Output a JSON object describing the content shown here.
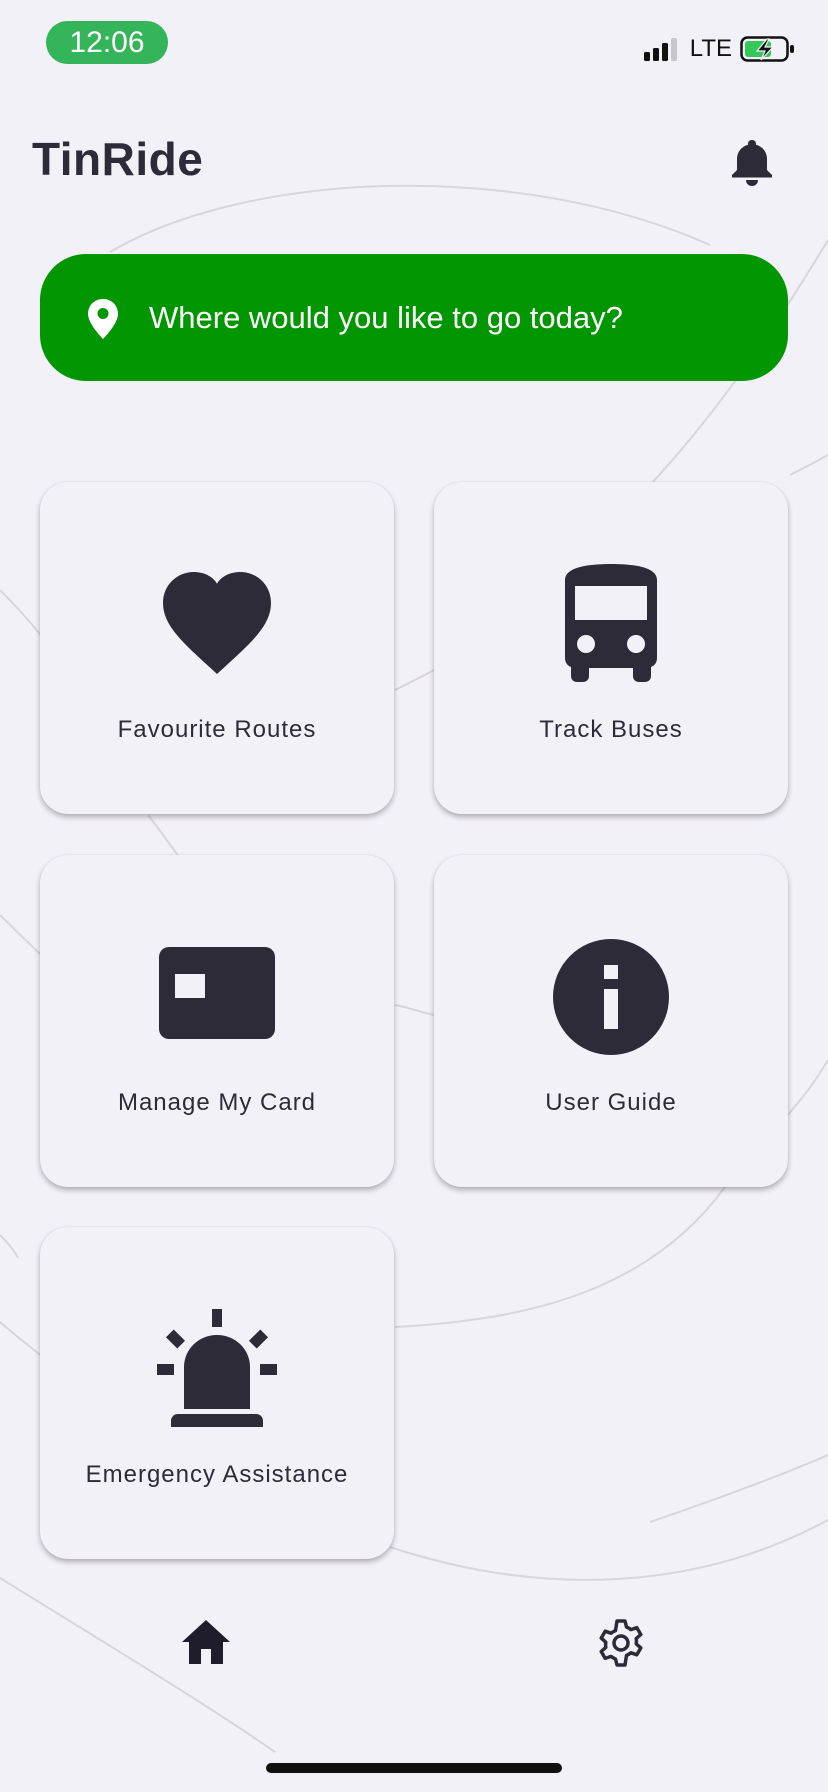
{
  "status_bar": {
    "time": "12:06",
    "network": "LTE",
    "time_pill_color": "#34b55a"
  },
  "header": {
    "title": "TinRide",
    "bell_icon": "bell-icon"
  },
  "search": {
    "placeholder": "Where would you like to go today?",
    "icon": "location-pin-icon",
    "background_color": "#029602"
  },
  "tiles": [
    {
      "label": "Favourite Routes",
      "icon": "heart-icon"
    },
    {
      "label": "Track Buses",
      "icon": "bus-icon"
    },
    {
      "label": "Manage My Card",
      "icon": "card-icon"
    },
    {
      "label": "User Guide",
      "icon": "info-icon"
    },
    {
      "label": "Emergency Assistance",
      "icon": "siren-icon"
    }
  ],
  "bottom_nav": {
    "items": [
      {
        "icon": "home-icon",
        "selected": true
      },
      {
        "icon": "gear-icon",
        "selected": false
      }
    ]
  },
  "colors": {
    "background": "#f3f1f8",
    "icon": "#2e2b38",
    "accent": "#029602"
  }
}
